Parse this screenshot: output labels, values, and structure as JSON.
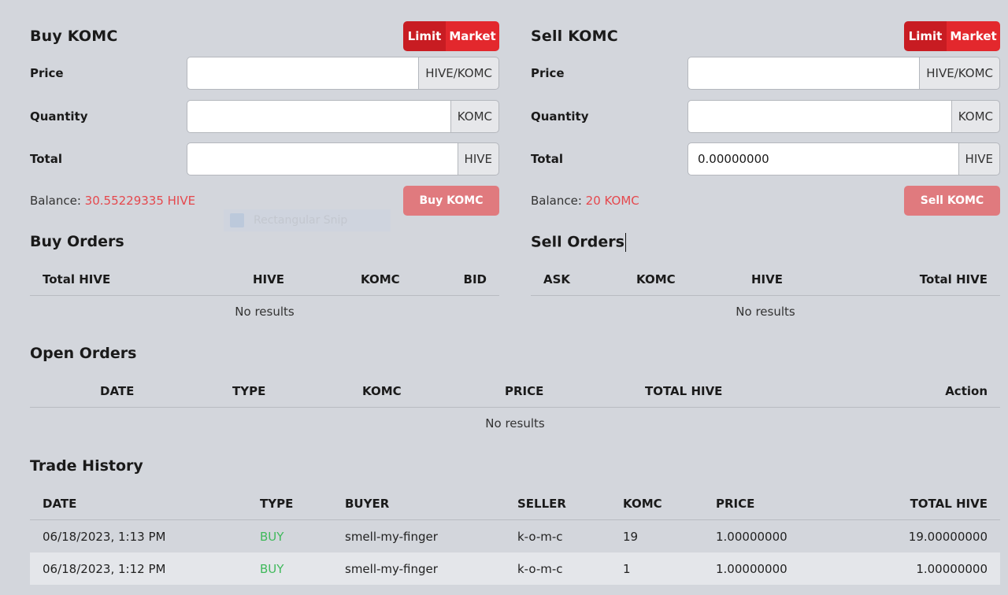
{
  "buy_form": {
    "title": "Buy KOMC",
    "toggle": {
      "limit": "Limit",
      "market": "Market"
    },
    "price": {
      "label": "Price",
      "value": "",
      "unit": "HIVE/KOMC"
    },
    "quantity": {
      "label": "Quantity",
      "value": "",
      "unit": "KOMC"
    },
    "total": {
      "label": "Total",
      "value": "",
      "unit": "HIVE"
    },
    "balance_label": "Balance:",
    "balance_value": "30.55229335 HIVE",
    "submit": "Buy KOMC"
  },
  "sell_form": {
    "title": "Sell KOMC",
    "toggle": {
      "limit": "Limit",
      "market": "Market"
    },
    "price": {
      "label": "Price",
      "value": "",
      "unit": "HIVE/KOMC"
    },
    "quantity": {
      "label": "Quantity",
      "value": "",
      "unit": "KOMC"
    },
    "total": {
      "label": "Total",
      "value": "0.00000000",
      "unit": "HIVE"
    },
    "balance_label": "Balance:",
    "balance_value": "20 KOMC",
    "submit": "Sell KOMC"
  },
  "snip_overlay": {
    "label": "Rectangular Snip"
  },
  "buy_orders": {
    "title": "Buy Orders",
    "columns": [
      "Total HIVE",
      "HIVE",
      "KOMC",
      "BID"
    ],
    "empty": "No results"
  },
  "sell_orders": {
    "title": "Sell Orders",
    "columns": [
      "ASK",
      "KOMC",
      "HIVE",
      "Total HIVE"
    ],
    "empty": "No results"
  },
  "open_orders": {
    "title": "Open Orders",
    "columns": [
      "DATE",
      "TYPE",
      "KOMC",
      "PRICE",
      "TOTAL HIVE",
      "Action"
    ],
    "empty": "No results"
  },
  "trade_history": {
    "title": "Trade History",
    "columns": [
      "DATE",
      "TYPE",
      "BUYER",
      "SELLER",
      "KOMC",
      "PRICE",
      "TOTAL HIVE"
    ],
    "rows": [
      [
        "06/18/2023, 1:13 PM",
        "BUY",
        "smell-my-finger",
        "k-o-m-c",
        "19",
        "1.00000000",
        "19.00000000"
      ],
      [
        "06/18/2023, 1:12 PM",
        "BUY",
        "smell-my-finger",
        "k-o-m-c",
        "1",
        "1.00000000",
        "1.00000000"
      ]
    ]
  },
  "colors": {
    "accent_red": "#e3282d",
    "balance_red": "#e5484d",
    "buy_green": "#3fb95b"
  }
}
